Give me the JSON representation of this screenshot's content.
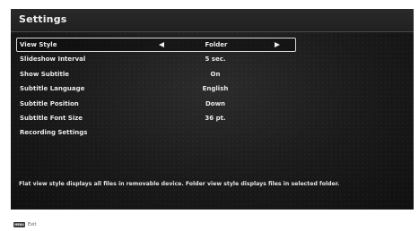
{
  "header": {
    "title": "Settings"
  },
  "menu": {
    "items": [
      {
        "label": "View Style",
        "value": "Folder",
        "selected": true
      },
      {
        "label": "Slideshow Interval",
        "value": "5 sec."
      },
      {
        "label": "Show Subtitle",
        "value": "On"
      },
      {
        "label": "Subtitle Language",
        "value": "English"
      },
      {
        "label": "Subtitle Position",
        "value": "Down"
      },
      {
        "label": "Subtitle Font Size",
        "value": "36 pt."
      },
      {
        "label": "Recording Settings",
        "value": ""
      }
    ]
  },
  "description": "Flat view style displays all files in removable device. Folder view style displays files in selected folder.",
  "footer": {
    "key_label": "MENU",
    "action_label": "Exit"
  },
  "icons": {
    "left": "arrow-left-icon",
    "right": "arrow-right-icon"
  }
}
